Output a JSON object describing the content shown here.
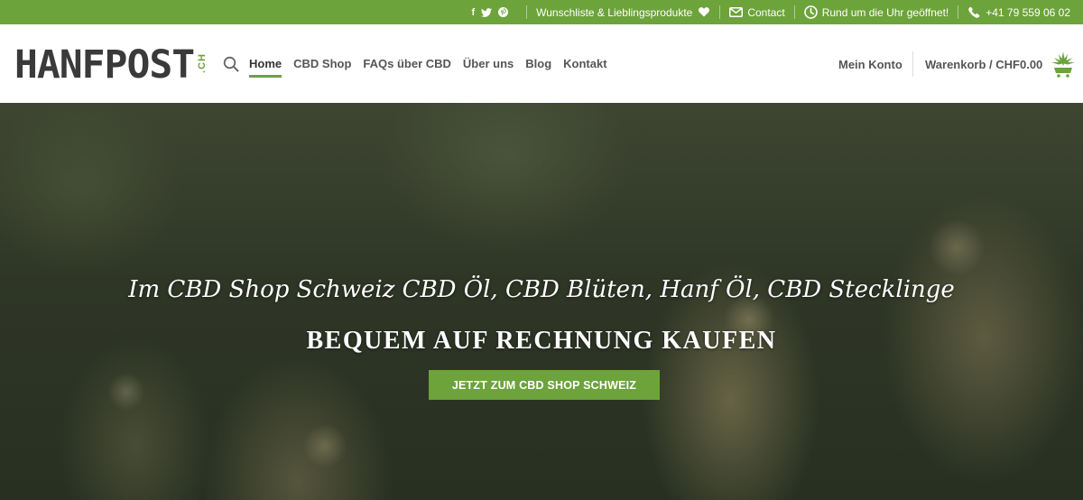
{
  "topbar": {
    "social": {
      "facebook": "f",
      "twitter": "t",
      "pinterest": "p"
    },
    "wishlist": "Wunschliste & Lieblingsprodukte",
    "contact": "Contact",
    "hours": "Rund um die Uhr geöffnet!",
    "phone": "+41 79 559 06 02",
    "bg_color": "#6ca33b"
  },
  "header": {
    "logo_text": "HANFPOST",
    "logo_suffix": ".CH",
    "nav": [
      {
        "label": "Home",
        "active": true
      },
      {
        "label": "CBD Shop",
        "active": false
      },
      {
        "label": "FAQs über CBD",
        "active": false
      },
      {
        "label": "Über uns",
        "active": false
      },
      {
        "label": "Blog",
        "active": false
      },
      {
        "label": "Kontakt",
        "active": false
      }
    ],
    "account": "Mein Konto",
    "cart": "Warenkorb / CHF0.00"
  },
  "hero": {
    "script_line": "Im CBD Shop Schweiz CBD Öl, CBD Blüten, Hanf Öl, CBD Stecklinge",
    "title": "BEQUEM AUF RECHNUNG KAUFEN",
    "button": "JETZT ZUM CBD SHOP SCHWEIZ"
  },
  "colors": {
    "accent": "#6ca33b",
    "text_dark": "#333333"
  }
}
